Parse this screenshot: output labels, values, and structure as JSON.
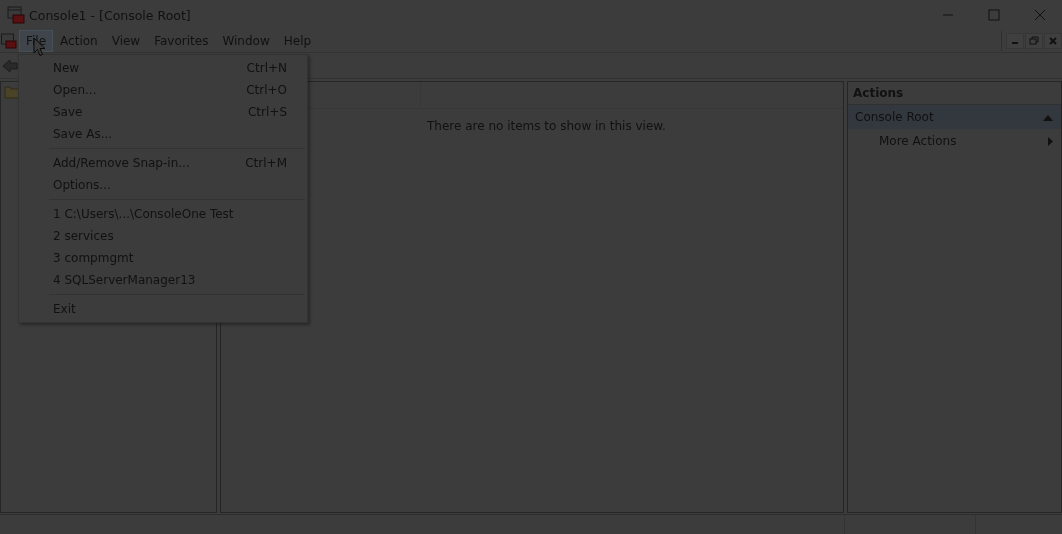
{
  "window": {
    "title": "Console1 - [Console Root]"
  },
  "menu_bar": [
    {
      "label": "File",
      "selected": true
    },
    {
      "label": "Action",
      "selected": false
    },
    {
      "label": "View",
      "selected": false
    },
    {
      "label": "Favorites",
      "selected": false
    },
    {
      "label": "Window",
      "selected": false
    },
    {
      "label": "Help",
      "selected": false
    }
  ],
  "file_menu": {
    "groups": [
      [
        {
          "label": "New",
          "shortcut": "Ctrl+N"
        },
        {
          "label": "Open...",
          "shortcut": "Ctrl+O"
        },
        {
          "label": "Save",
          "shortcut": "Ctrl+S"
        },
        {
          "label": "Save As..."
        }
      ],
      [
        {
          "label": "Add/Remove Snap-in...",
          "shortcut": "Ctrl+M"
        },
        {
          "label": "Options..."
        }
      ],
      [
        {
          "label": "1 C:\\Users\\...\\ConsoleOne Test"
        },
        {
          "label": "2 services"
        },
        {
          "label": "3 compmgmt"
        },
        {
          "label": "4 SQLServerManager13"
        }
      ],
      [
        {
          "label": "Exit"
        }
      ]
    ]
  },
  "content": {
    "empty_message": "There are no items to show in this view."
  },
  "actions": {
    "title": "Actions",
    "section": {
      "label": "Console Root",
      "expanded": true
    },
    "items": [
      {
        "label": "More Actions"
      }
    ]
  }
}
